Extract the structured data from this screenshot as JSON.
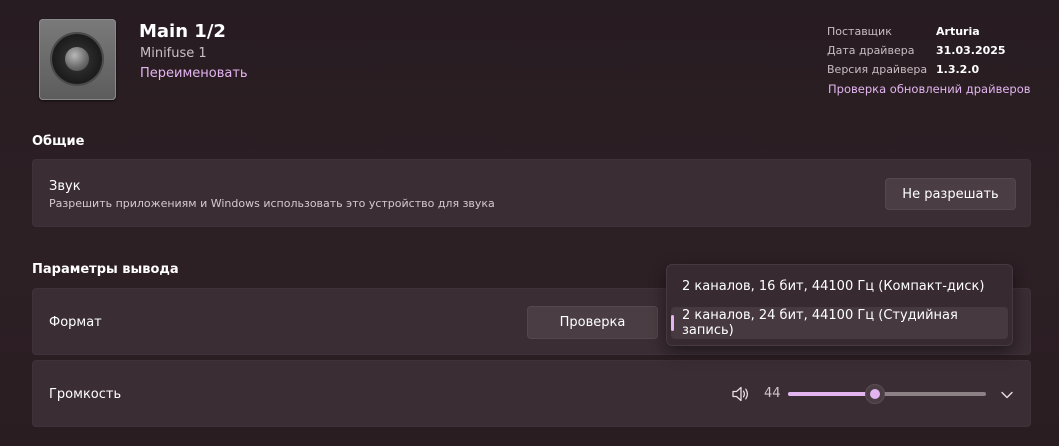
{
  "header": {
    "title": "Main 1/2",
    "subtitle": "Minifuse 1",
    "rename_link": "Переименовать",
    "device_icon": "speaker-icon"
  },
  "driver_info": {
    "rows": [
      {
        "label": "Поставщик",
        "value": "Arturia"
      },
      {
        "label": "Дата драйвера",
        "value": "31.03.2025"
      },
      {
        "label": "Версия драйвера",
        "value": "1.3.2.0"
      }
    ],
    "update_link": "Проверка обновлений драйверов"
  },
  "general": {
    "section_title": "Общие",
    "sound": {
      "label": "Звук",
      "description": "Разрешить приложениям и Windows использовать это устройство для звука",
      "button_label": "Не разрешать"
    }
  },
  "output": {
    "section_title": "Параметры вывода",
    "format": {
      "label": "Формат",
      "test_button_label": "Проверка",
      "options": [
        "2 каналов, 16 бит, 44100 Гц (Компакт-диск)",
        "2 каналов, 24 бит, 44100 Гц (Студийная запись)"
      ],
      "selected_index": 1
    },
    "volume": {
      "label": "Громкость",
      "value": "44",
      "level_fraction": 0.44,
      "volume_icon": "speaker-volume-icon",
      "expand_icon": "chevron-down-icon"
    }
  },
  "colors": {
    "accent": "#e3b5f0",
    "background": "#2b1f24",
    "card": "#3a2d33"
  }
}
